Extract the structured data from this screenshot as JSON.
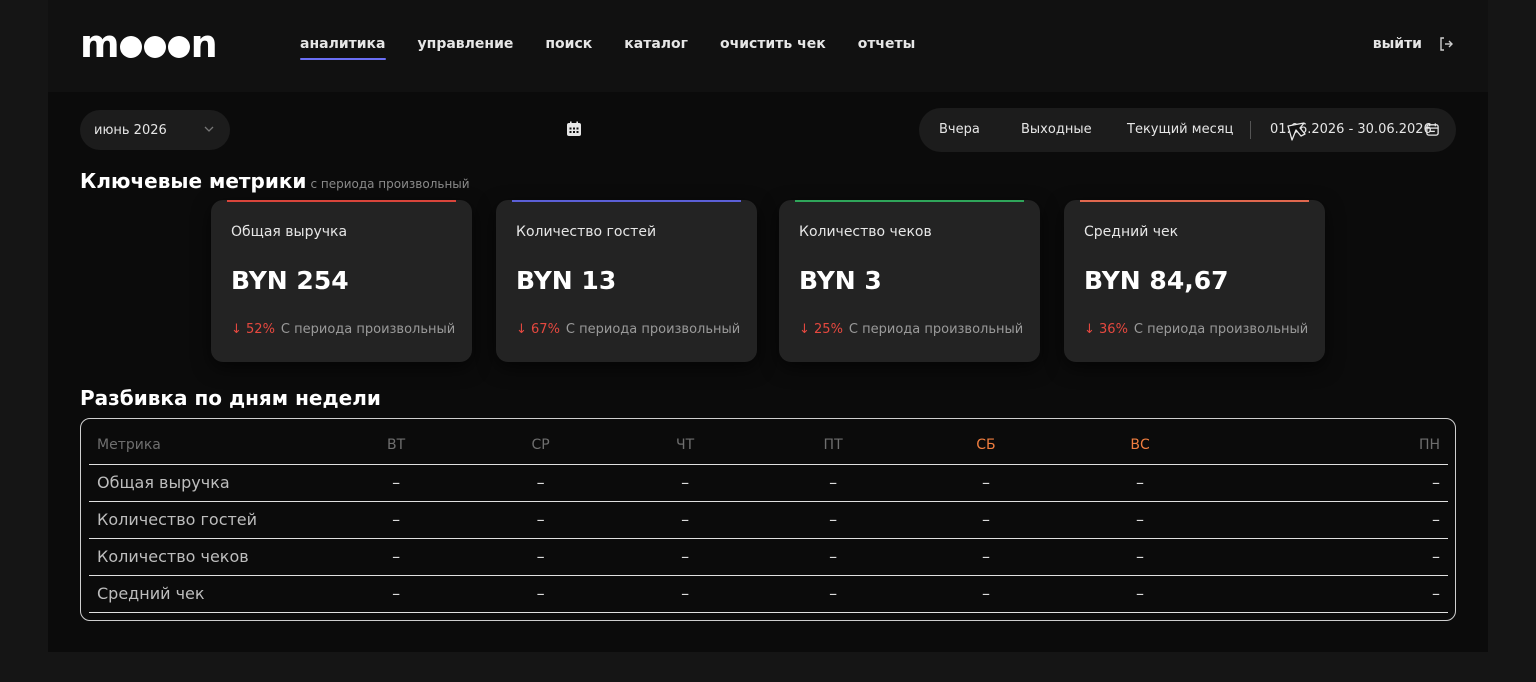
{
  "app": {
    "logo": "mooon"
  },
  "nav": {
    "items": [
      {
        "label": "аналитика",
        "active": true
      },
      {
        "label": "управление"
      },
      {
        "label": "поиск"
      },
      {
        "label": "каталог"
      },
      {
        "label": "очистить чек"
      },
      {
        "label": "отчеты"
      }
    ],
    "logout_label": "выйти"
  },
  "filters": {
    "month": "июнь 2026",
    "presets": [
      "Вчера",
      "Выходные",
      "Текущий месяц"
    ],
    "range": "01.06.2026 - 30.06.2026"
  },
  "metrics": {
    "title": "Ключевые метрики",
    "subtitle": "с периода произвольный",
    "cards": [
      {
        "label": "Общая выручка",
        "value": "BYN 254",
        "delta": "↓ 52%",
        "delta_note": "С периода произвольный",
        "accent": "#d9453b"
      },
      {
        "label": "Количество гостей",
        "value": "BYN 13",
        "delta": "↓ 67%",
        "delta_note": "С периода произвольный",
        "accent": "#5b5fd6"
      },
      {
        "label": "Количество чеков",
        "value": "BYN 3",
        "delta": "↓ 25%",
        "delta_note": "С периода произвольный",
        "accent": "#2fa55a"
      },
      {
        "label": "Средний чек",
        "value": "BYN 84,67",
        "delta": "↓ 36%",
        "delta_note": "С периода произвольный",
        "accent": "#e0674e"
      }
    ]
  },
  "breakdown": {
    "title": "Разбивка по дням недели",
    "columns": [
      "Метрика",
      "ВТ",
      "СР",
      "ЧТ",
      "ПТ",
      "СБ",
      "ВС",
      "ПН"
    ],
    "rows": [
      {
        "label": "Общая выручка",
        "cells": [
          "–",
          "–",
          "–",
          "–",
          "–",
          "–",
          "–"
        ]
      },
      {
        "label": "Количество гостей",
        "cells": [
          "–",
          "–",
          "–",
          "–",
          "–",
          "–",
          "–"
        ]
      },
      {
        "label": "Количество чеков",
        "cells": [
          "–",
          "–",
          "–",
          "–",
          "–",
          "–",
          "–"
        ]
      },
      {
        "label": "Средний чек",
        "cells": [
          "–",
          "–",
          "–",
          "–",
          "–",
          "–",
          "–"
        ]
      }
    ],
    "weekend_color": "#ef7d3f"
  },
  "colors": {
    "nav_active_underline": "#6b6ff5",
    "negative": "#e5483f"
  }
}
